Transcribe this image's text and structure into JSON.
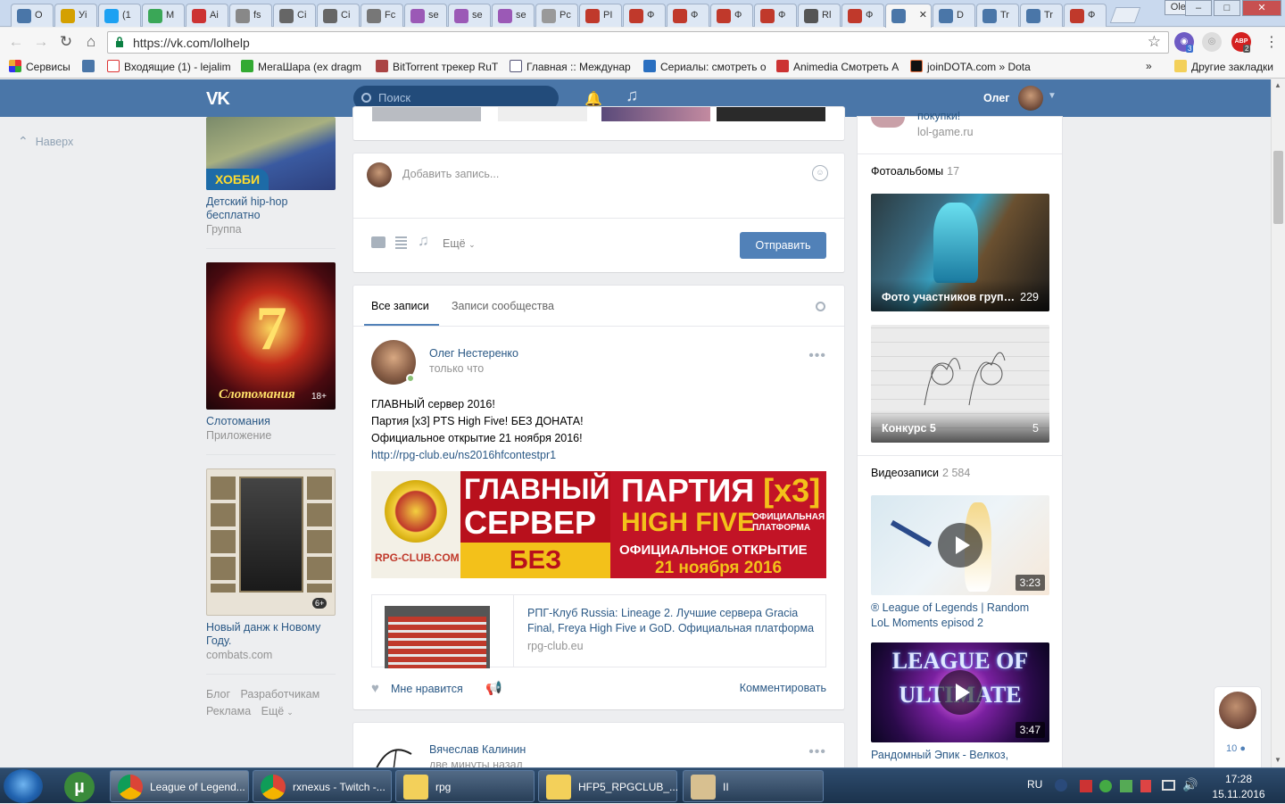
{
  "browser": {
    "tabs": [
      "О",
      "Уі",
      "(1",
      "М",
      "Аі",
      "fs",
      "Ci",
      "Ci",
      "Fc",
      "se",
      "se",
      "se",
      "Pc",
      "РІ",
      "Ф",
      "Ф",
      "Ф",
      "Ф",
      "Rl",
      "Ф",
      "",
      "D",
      "Tr",
      "Tr",
      "Ф"
    ],
    "profile_name": "Oleg",
    "url": "https://vk.com/lolhelp",
    "bookmarks": [
      "Сервисы",
      "",
      "Входящие (1) - lejalim",
      "МегаШара (ex dragm",
      "BitTorrent трекер RuT",
      "Главная :: Междунар",
      "Сериалы: смотреть о",
      "Animedia Смотреть А",
      "joinDOTA.com » Dota"
    ],
    "bookmarks_more": "»",
    "other_bookmarks": "Другие закладки",
    "ext_badges": [
      "3",
      "2"
    ],
    "ext_abp": "ABP"
  },
  "vk": {
    "logo": "VK",
    "search_placeholder": "Поиск",
    "user_name": "Олег",
    "to_top": "Наверх",
    "left_items": [
      {
        "title": "Детский hip-hop бесплатно",
        "sub": "Группа",
        "badge": "ХОББИ"
      },
      {
        "title": "Слотомания",
        "sub": "Приложение",
        "badge": "18+",
        "logo_text": "Слотомания"
      },
      {
        "title": "Новый данж к Новому Году.",
        "sub": "combats.com",
        "badge": "6+"
      }
    ],
    "footer_links": [
      "Блог",
      "Разработчикам",
      "Реклама",
      "Ещё"
    ],
    "composer": {
      "placeholder": "Добавить запись...",
      "more": "Ещё",
      "submit": "Отправить"
    },
    "tabs": [
      "Все записи",
      "Записи сообщества"
    ],
    "post": {
      "author": "Олег Нестеренко",
      "time": "только что",
      "lines": [
        "ГЛАВНЫЙ сервер 2016!",
        "Партия [x3] PTS High Five! БЕЗ ДОНАТА!",
        "Официальное открытие 21 ноября 2016!"
      ],
      "link": "http://rpg-club.eu/ns2016hfcontestpr1",
      "banner": {
        "logo": "RPG-CLUB.COM",
        "l1": "ГЛАВНЫЙ",
        "l2": "СЕРВЕР",
        "l3": "БЕЗ ДОНАТА",
        "r1": "ПАРТИЯ",
        "r1b": "[x3]",
        "r2": "HIGH FIVE",
        "r2s": "ОФИЦИАЛЬНАЯ ПЛАТФОРМА",
        "r3": "ОФИЦИАЛЬНОЕ ОТКРЫТИЕ",
        "r4": "21 ноября 2016"
      },
      "snippet_title": "РПГ-Клуб Russia: Lineage 2. Лучшие сервера Gracia Final, Freya High Five и GoD. Официальная платформа",
      "snippet_domain": "rpg-club.eu",
      "like": "Мне нравится",
      "comment": "Комментировать"
    },
    "post2": {
      "author": "Вячеслав Калинин",
      "time": "две минуты назад"
    },
    "right": {
      "ad_title": "покупки!",
      "ad_domain": "lol-game.ru",
      "albums_label": "Фотоальбомы",
      "albums_count": "17",
      "albums": [
        {
          "title": "Фото участников груп…",
          "count": "229"
        },
        {
          "title": "Конкурс 5",
          "count": "5"
        }
      ],
      "videos_label": "Видеозаписи",
      "videos_count": "2 584",
      "videos": [
        {
          "title": "® League of Legends | Random LoL Moments episod 2",
          "duration": "3:23"
        },
        {
          "title": "Рандомный Эпик - Велкоз,",
          "duration": "3:47",
          "art": "LEAGUE OF ULTIMATE"
        }
      ]
    },
    "chat_count": "10"
  },
  "taskbar": {
    "items": [
      "League of Legend...",
      "rxnexus - Twitch -...",
      "rpg",
      "HFP5_RPGCLUB_...",
      "II"
    ],
    "lang": "RU",
    "time": "17:28",
    "date": "15.11.2016"
  }
}
